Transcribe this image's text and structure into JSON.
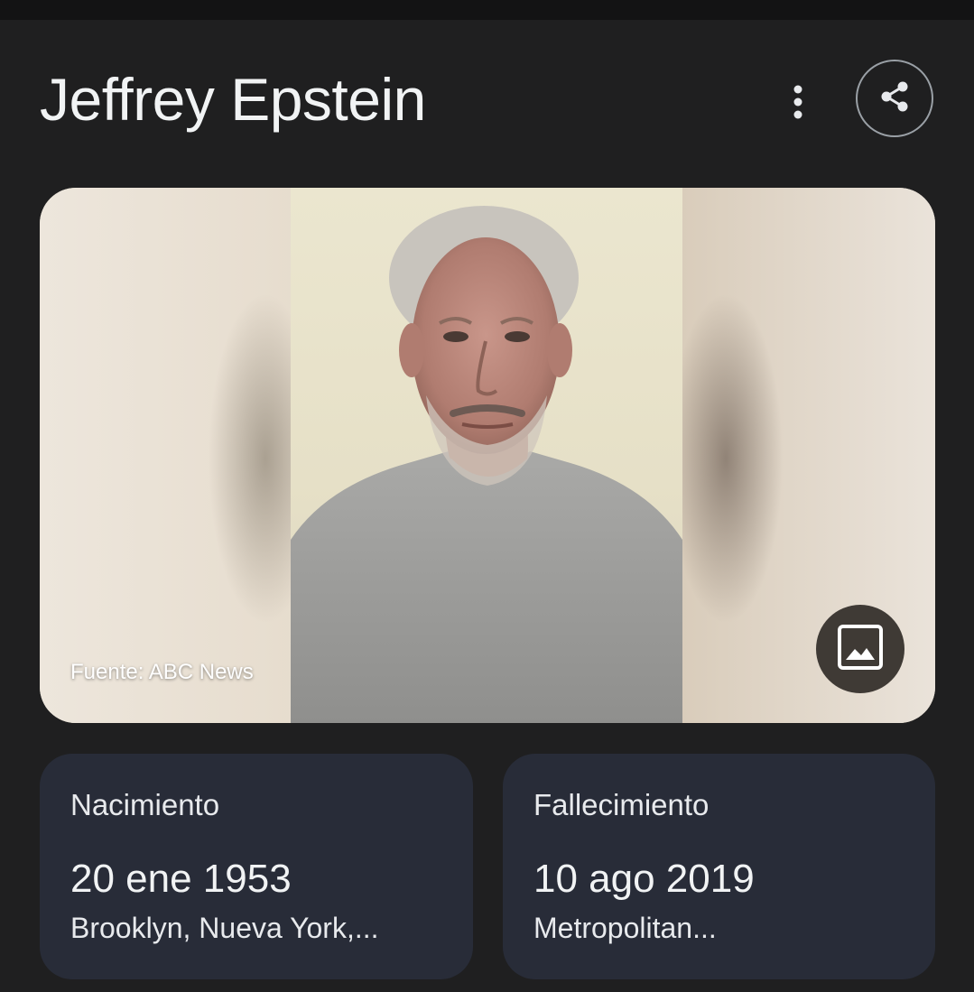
{
  "header": {
    "title": "Jeffrey Epstein",
    "more_icon": "more-vert-icon",
    "share_icon": "share-icon"
  },
  "image": {
    "source": "Fuente: ABC News",
    "image_icon": "image-icon"
  },
  "facts": {
    "birth": {
      "label": "Nacimiento",
      "date": "20 ene 1953",
      "place": "Brooklyn, Nueva York,..."
    },
    "death": {
      "label": "Fallecimiento",
      "date": "10 ago 2019",
      "place": "Metropolitan..."
    }
  },
  "colors": {
    "background": "#1f1f20",
    "card": "#282c38",
    "text": "#e8eaed"
  }
}
